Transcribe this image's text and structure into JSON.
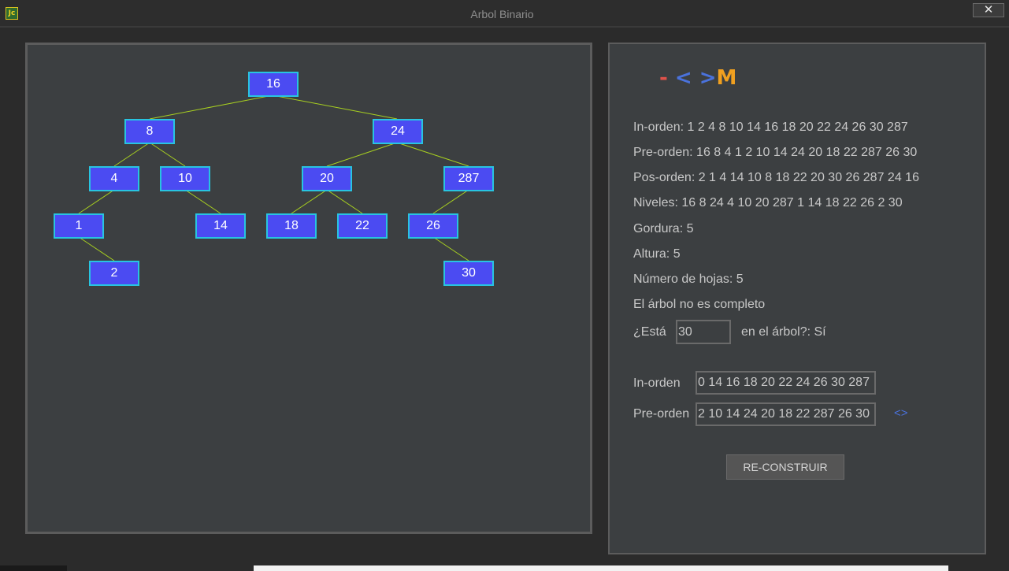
{
  "window": {
    "title": "Arbol Binario",
    "app_icon_text": "Jc",
    "close_symbol": "✕"
  },
  "tree": {
    "edge_color": "#a8d020",
    "node_fill": "#4b4bf2",
    "node_border": "#28c4e0",
    "nodes": [
      {
        "id": "n16",
        "value": "16"
      },
      {
        "id": "n8",
        "value": "8"
      },
      {
        "id": "n24",
        "value": "24"
      },
      {
        "id": "n4",
        "value": "4"
      },
      {
        "id": "n10",
        "value": "10"
      },
      {
        "id": "n20",
        "value": "20"
      },
      {
        "id": "n287",
        "value": "287"
      },
      {
        "id": "n1",
        "value": "1"
      },
      {
        "id": "n14",
        "value": "14"
      },
      {
        "id": "n18",
        "value": "18"
      },
      {
        "id": "n22",
        "value": "22"
      },
      {
        "id": "n26",
        "value": "26"
      },
      {
        "id": "n2",
        "value": "2"
      },
      {
        "id": "n30",
        "value": "30"
      }
    ],
    "edges": [
      [
        "16",
        "8"
      ],
      [
        "16",
        "24"
      ],
      [
        "8",
        "4"
      ],
      [
        "8",
        "10"
      ],
      [
        "24",
        "20"
      ],
      [
        "24",
        "287"
      ],
      [
        "4",
        "1"
      ],
      [
        "10",
        "14"
      ],
      [
        "20",
        "18"
      ],
      [
        "20",
        "22"
      ],
      [
        "287",
        "26"
      ],
      [
        "1",
        "2"
      ],
      [
        "26",
        "30"
      ]
    ]
  },
  "logo": {
    "minus": "-",
    "lt": "<",
    "gt": ">",
    "m": "M"
  },
  "info": {
    "inorden": "In-orden: 1 2 4 8 10 14 16 18 20 22 24 26 30 287",
    "preorden": "Pre-orden: 16 8 4 1 2 10 14 24 20 18 22 287 26 30",
    "posorden": "Pos-orden: 2 1 4 14 10 8 18 22 20 30 26 287 24 16",
    "niveles": "Niveles: 16 8 24 4 10 20 287 1 14 18 22 26 2 30",
    "gordura": "Gordura: 5",
    "altura": "Altura: 5",
    "hojas": "Número de hojas: 5",
    "completo": "El árbol no es completo"
  },
  "search": {
    "label": "¿Está",
    "value": "30",
    "result": "en el árbol?: Sí"
  },
  "rebuild": {
    "inorden_label": "In-orden",
    "inorden_value": "0 14 16 18 20 22 24 26 30 287",
    "preorden_label": "Pre-orden",
    "preorden_value": "2 10 14 24 20 18 22 287 26 30",
    "arrows": "<>",
    "button": "RE-CONSTRUIR"
  }
}
